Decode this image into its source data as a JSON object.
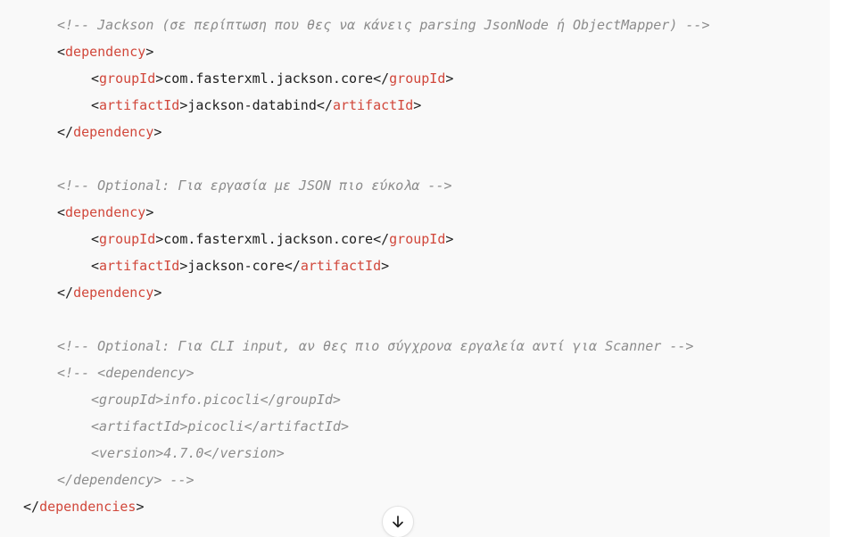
{
  "code": {
    "comment_jackson": "<!-- Jackson (σε περίπτωση που θες να κάνεις parsing JsonNode ή ObjectMapper) -->",
    "comment_optional_json": "<!-- Optional: Για εργασία με JSON πιο εύκολα -->",
    "comment_optional_cli": "<!-- Optional: Για CLI input, αν θες πιο σύγχρονα εργαλεία αντί για Scanner -->",
    "comment_dep_open": "<!-- <dependency>",
    "comment_group_line": "<groupId>info.picocli</groupId>",
    "comment_artifact_line": "<artifactId>picocli</artifactId>",
    "comment_version_line": "<version>4.7.0</version>",
    "comment_dep_close": "</dependency> -->",
    "tag_dependency": "dependency",
    "tag_groupId": "groupId",
    "tag_artifactId": "artifactId",
    "tag_dependencies": "dependencies",
    "lt": "<",
    "gt": ">",
    "lt_slash": "</",
    "dep1_group": "com.fasterxml.jackson.core",
    "dep1_artifact": "jackson-databind",
    "dep2_group": "com.fasterxml.jackson.core",
    "dep2_artifact": "jackson-core"
  },
  "controls": {
    "scroll_down_icon": "arrow-down-icon"
  },
  "colors": {
    "tag": "#d1473b",
    "comment": "#8c8c8c",
    "text": "#1f1f1f",
    "background": "#f9f9f9"
  }
}
